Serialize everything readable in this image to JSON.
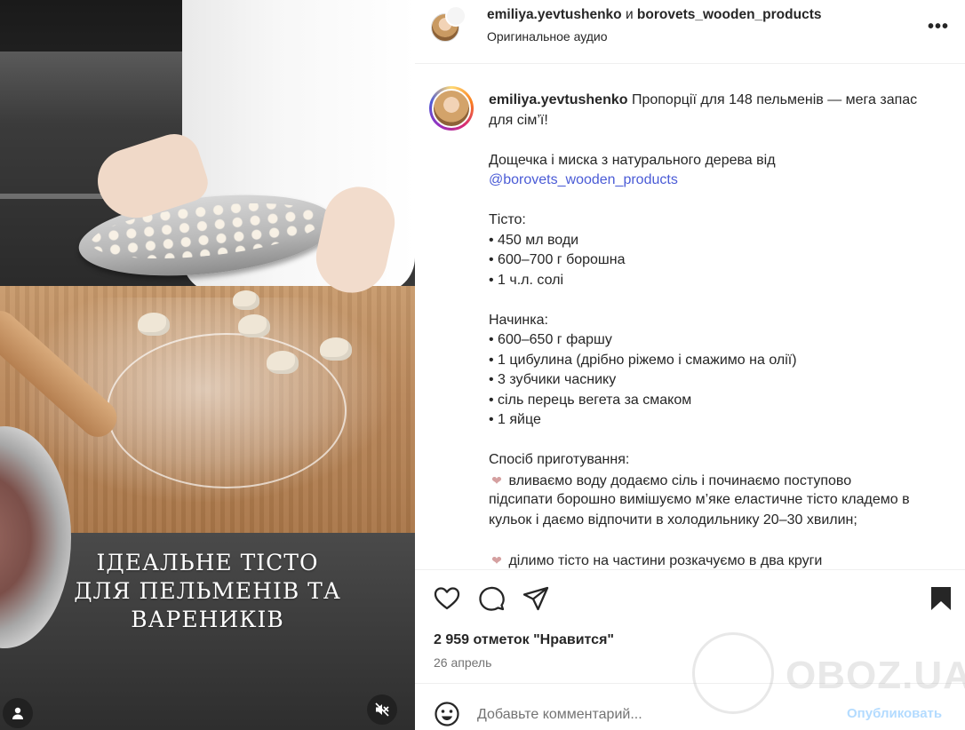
{
  "video": {
    "overlay_line1": "ІДЕАЛЬНЕ ТІСТО",
    "overlay_line2": "ДЛЯ ПЕЛЬМЕНІВ ТА ВАРЕНИКІВ",
    "user_icon": "user-icon",
    "mute_icon": "muted-speaker-icon"
  },
  "header": {
    "author": "emiliya.yevtushenko",
    "conjunction": "и",
    "coauthor": "borovets_wooden_products",
    "audio": "Оригинальное аудио",
    "more_icon": "more-options-icon"
  },
  "caption": {
    "user": "emiliya.yevtushenko",
    "lines": [
      "Пропорції для 148 пельменів — мега запас",
      "для сім’ї!",
      "",
      "Дощечка і миска з натурального дерева від",
      "@borovets_wooden_products",
      "",
      "Тісто:",
      "• 450 мл води",
      "• 600–700 г борошна",
      "• 1 ч.л. солі",
      "",
      "Начинка:",
      "• 600–650 г фаршу",
      "• 1 цибулина (дрібно ріжемо і смажимо на олії)",
      "• 3 зубчики часнику",
      "• сіль перець вегета за смаком",
      "• 1 яйце",
      "",
      "Спосіб приготування:",
      "вливаємо воду додаємо сіль і починаємо поступово",
      "підсипати борошно вимішуємо м’яке еластичне тісто кладемо в",
      "кульок і даємо відпочити в холодильнику 20–30 хвилин;",
      "",
      "ділимо тісто на частини розкачуємо в два круги"
    ]
  },
  "actions": {
    "like_icon": "heart-icon",
    "comment_icon": "comment-bubble-icon",
    "share_icon": "paper-plane-icon",
    "bookmark_icon": "bookmark-icon",
    "likes": "2 959 отметок \"Нравится\"",
    "date": "26 апрель"
  },
  "comment": {
    "placeholder": "Добавьте комментарий...",
    "publish": "Опубликовать",
    "emoji_icon": "smiley-icon"
  },
  "watermark": {
    "text": "OBOZ.UA"
  },
  "colors": {
    "mention": "#4a5bd6",
    "publish_disabled": "#b3dbff",
    "secondary_text": "#737373"
  }
}
